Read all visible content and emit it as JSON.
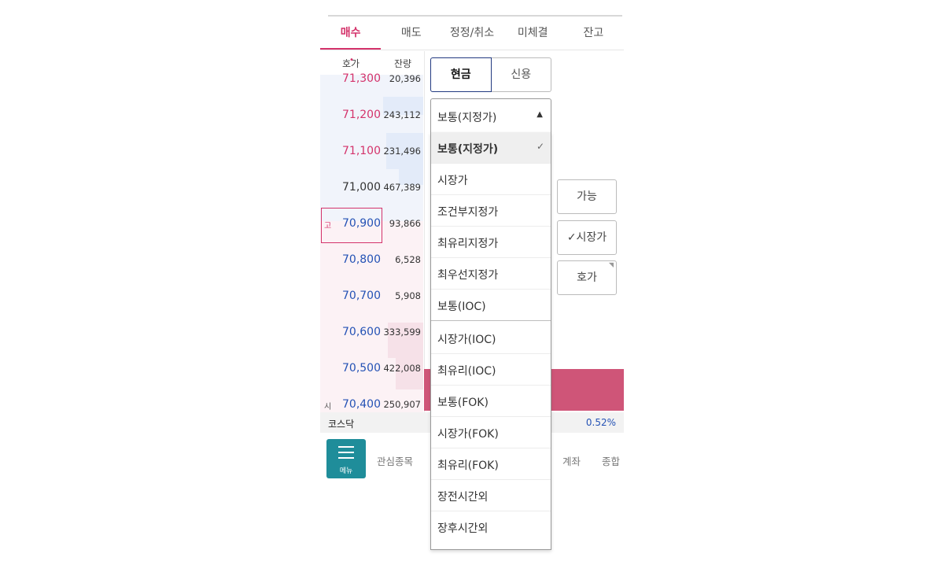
{
  "tabs": [
    {
      "label": "매수",
      "active": true
    },
    {
      "label": "매도",
      "active": false
    },
    {
      "label": "정정/취소",
      "active": false
    },
    {
      "label": "미체결",
      "active": false
    },
    {
      "label": "잔고",
      "active": false
    }
  ],
  "order_book": {
    "header_price": "호가",
    "header_qty": "잔량",
    "header_marker": "•",
    "rows": [
      {
        "price": "71,300",
        "qty": "20,396",
        "dir": "up"
      },
      {
        "price": "71,200",
        "qty": "243,112",
        "dir": "up"
      },
      {
        "price": "71,100",
        "qty": "231,496",
        "dir": "up"
      },
      {
        "price": "71,000",
        "qty": "467,389",
        "dir": "flat"
      },
      {
        "price": "70,900",
        "qty": "93,866",
        "dir": "down",
        "marker": "고"
      },
      {
        "price": "70,800",
        "qty": "6,528",
        "dir": "down"
      },
      {
        "price": "70,700",
        "qty": "5,908",
        "dir": "down"
      },
      {
        "price": "70,600",
        "qty": "333,599",
        "dir": "down"
      },
      {
        "price": "70,500",
        "qty": "422,008",
        "dir": "down"
      },
      {
        "price": "70,400",
        "qty": "250,907",
        "dir": "down",
        "marker": "시"
      }
    ]
  },
  "payment_toggle": {
    "cash": "현금",
    "credit": "신용"
  },
  "order_type": {
    "selected": "보통(지정가)",
    "arrow": "▲",
    "options": [
      {
        "label": "보통(지정가)",
        "selected": true,
        "check": "✓"
      },
      {
        "label": "시장가"
      },
      {
        "label": "조건부지정가"
      },
      {
        "label": "최유리지정가"
      },
      {
        "label": "최우선지정가"
      },
      {
        "label": "보통(IOC)",
        "separator_after": true
      },
      {
        "label": "시장가(IOC)"
      },
      {
        "label": "최유리(IOC)"
      },
      {
        "label": "보통(FOK)"
      },
      {
        "label": "시장가(FOK)"
      },
      {
        "label": "최유리(FOK)"
      },
      {
        "label": "장전시간외"
      },
      {
        "label": "장후시간외"
      }
    ]
  },
  "side_buttons": {
    "available": "가능",
    "market": "✓시장가",
    "quote": "호가",
    "quote_corner": "◥"
  },
  "status": {
    "market": "코스닥",
    "change": "0.52%"
  },
  "bottom_nav": {
    "menu": "메뉴",
    "watchlist": "관심종목",
    "account": "계좌",
    "summary": "종합"
  },
  "colors": {
    "accent": "#d4336b",
    "down": "#2452b5",
    "menu_bg": "#1f8d9a"
  }
}
